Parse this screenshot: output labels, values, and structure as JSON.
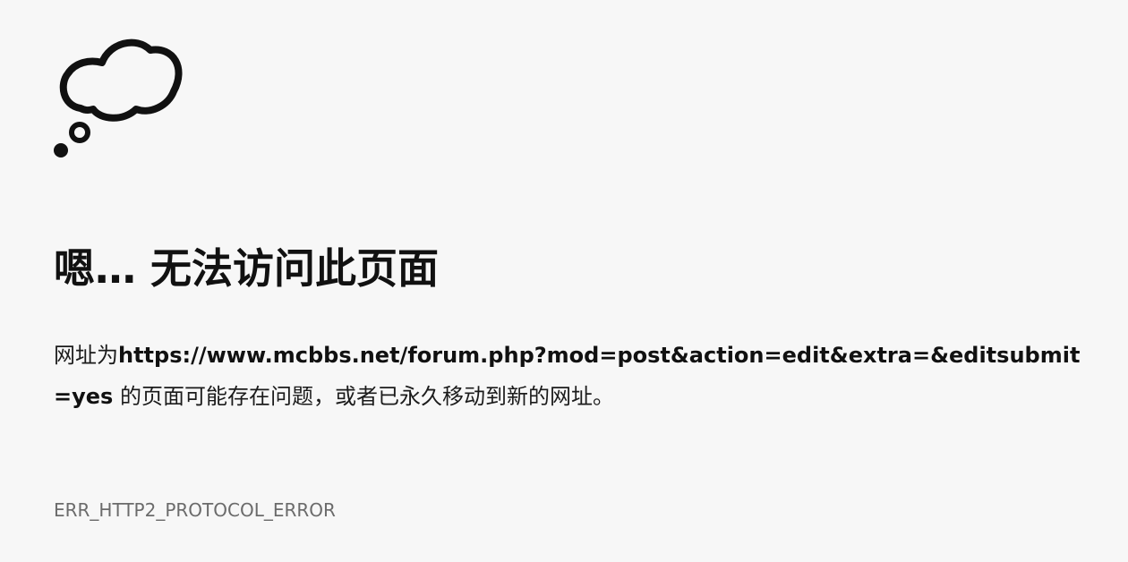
{
  "error_page": {
    "icon": "thought-bubble-icon",
    "title": "嗯… 无法访问此页面",
    "message_prefix": "网址为",
    "url": "https://www.mcbbs.net/forum.php?mod=post&action=edit&extra=&editsubmit=yes",
    "message_suffix": " 的页面可能存在问题，或者已永久移动到新的网址。",
    "error_code": "ERR_HTTP2_PROTOCOL_ERROR"
  },
  "colors": {
    "background": "#f7f7f7",
    "title": "#111111",
    "body_text": "#1b1b1b",
    "error_code": "#6b6b6b"
  }
}
